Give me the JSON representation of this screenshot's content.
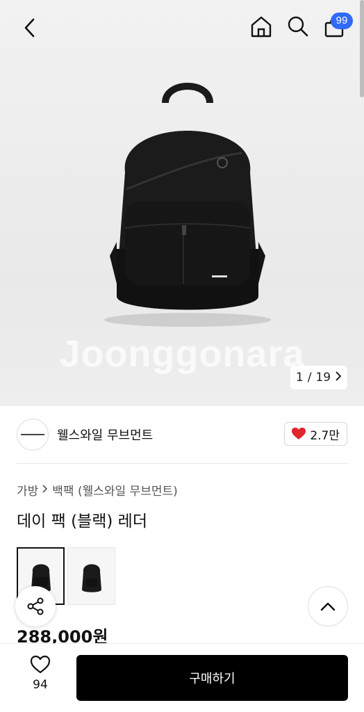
{
  "header": {
    "back_icon": "chevron-left-icon",
    "home_icon": "home-icon",
    "search_icon": "search-icon",
    "cart_icon": "shopping-bag-icon",
    "cart_count": "99"
  },
  "gallery": {
    "watermark": "Joonggonara",
    "current": "1",
    "separator": "/",
    "total": "19",
    "next_icon": "chevron-right-icon"
  },
  "shop": {
    "name": "웰스와일 무브먼트",
    "like_icon": "heart-icon",
    "likes": "2.7만",
    "like_color": "#e0262b"
  },
  "breadcrumb": {
    "category": "가방",
    "subcategory": "백팩 (웰스와일 무브먼트)"
  },
  "product": {
    "title": "데이 팩 (블랙) 레더",
    "price": "288,000원"
  },
  "actions": {
    "share_icon": "share-icon",
    "scroll_top_icon": "chevron-up-icon",
    "wish_icon": "heart-outline-icon",
    "wish_count": "94",
    "buy_label": "구매하기"
  },
  "colors": {
    "badge": "#2f6bf6",
    "buy_button": "#000000"
  }
}
